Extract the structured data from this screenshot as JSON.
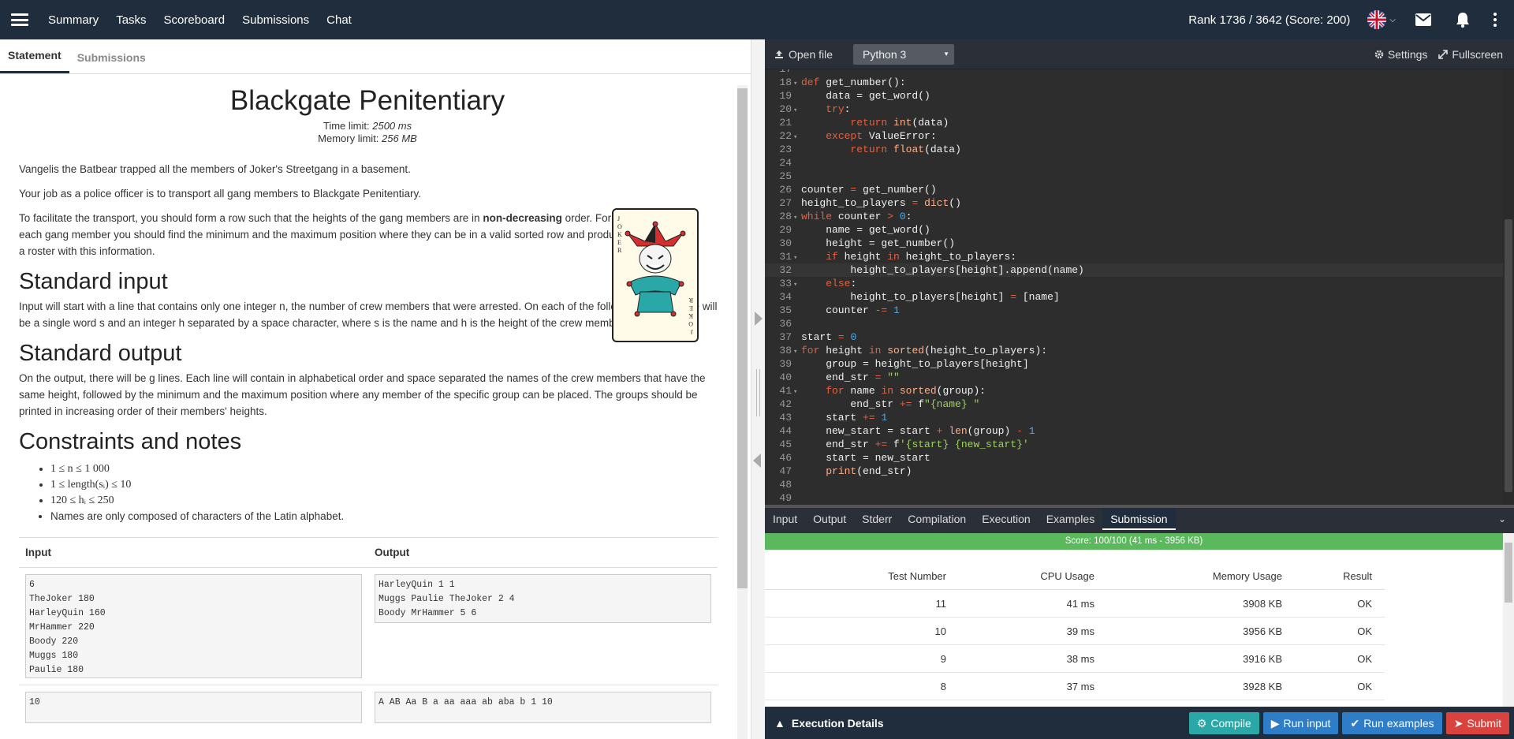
{
  "nav": {
    "items": [
      "Summary",
      "Tasks",
      "Scoreboard",
      "Submissions",
      "Chat"
    ],
    "rank": "Rank 1736 / 3642 (Score: 200)"
  },
  "left_tabs": [
    "Statement",
    "Submissions"
  ],
  "problem": {
    "title": "Blackgate Penitentiary",
    "time_limit_label": "Time limit: ",
    "time_limit": "2500 ms",
    "memory_limit_label": "Memory limit: ",
    "memory_limit": "256 MB",
    "p1": "Vangelis the Batbear trapped all the members of Joker's Streetgang in a basement.",
    "p2": "Your job as a police officer is to transport all gang members to Blackgate Penitentiary.",
    "p3_a": "To facilitate the transport, you should form a row such that the heights of the gang members are in ",
    "p3_b": "non-decreasing",
    "p3_c": " order. For each gang member you should find the minimum and the maximum position where they can be in a valid sorted row and produce a roster with this information.",
    "input_heading": "Standard input",
    "input_text": "Input will start with a line that contains only one integer n, the number of crew members that were arrested. On each of the following n lines there will be a single word s and an integer h separated by a space character, where s is the name and h is the height of the crew member.",
    "output_heading": "Standard output",
    "output_text": "On the output, there will be g lines. Each line will contain in alphabetical order and space separated the names of the crew members that have the same height, followed by the minimum and the maximum position where any member of the specific group can be placed. The groups should be printed in increasing order of their members' heights.",
    "constraints_heading": "Constraints and notes",
    "constraints": [
      "1 ≤ n ≤ 1 000",
      "1 ≤ length(sᵢ) ≤ 10",
      "120 ≤ hᵢ ≤ 250",
      "Names are only composed of characters of the Latin alphabet."
    ],
    "io_headers": [
      "Input",
      "Output"
    ],
    "example1_input": "6\nTheJoker 180\nHarleyQuin 160\nMrHammer 220\nBoody 220\nMuggs 180\nPaulie 180",
    "example1_output": "HarleyQuin 1 1\nMuggs Paulie TheJoker 2 4\nBoody MrHammer 5 6",
    "example2_input": "10",
    "example2_output": "A AB Aa B a aa aaa ab aba b 1 10"
  },
  "editor": {
    "open_file": "Open file",
    "language": "Python 3",
    "settings": "Settings",
    "fullscreen": "Fullscreen"
  },
  "panel_tabs": [
    "Input",
    "Output",
    "Stderr",
    "Compilation",
    "Execution",
    "Examples",
    "Submission"
  ],
  "results": {
    "score": "Score: 100/100 (41 ms - 3956 KB)",
    "headers": [
      "Test Number",
      "CPU Usage",
      "Memory Usage",
      "Result"
    ],
    "rows": [
      [
        "11",
        "41 ms",
        "3908 KB",
        "OK"
      ],
      [
        "10",
        "39 ms",
        "3956 KB",
        "OK"
      ],
      [
        "9",
        "38 ms",
        "3916 KB",
        "OK"
      ],
      [
        "8",
        "37 ms",
        "3928 KB",
        "OK"
      ]
    ]
  },
  "bottom": {
    "exec_details": "Execution Details",
    "compile": "Compile",
    "run_input": "Run input",
    "run_examples": "Run examples",
    "submit": "Submit"
  }
}
